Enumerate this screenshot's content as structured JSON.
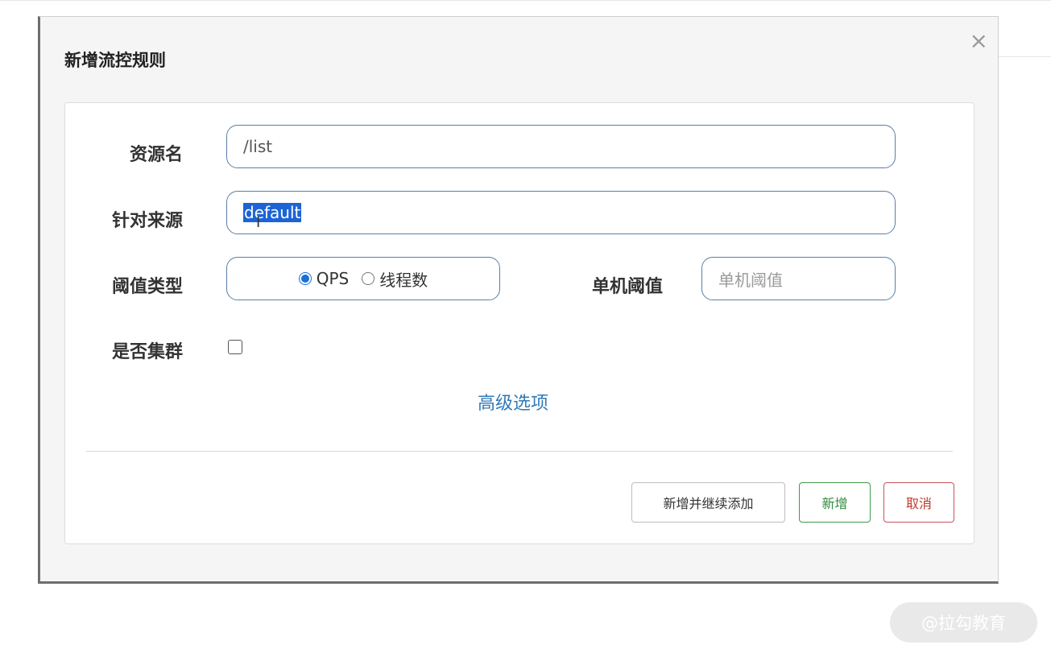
{
  "dialog": {
    "title": "新增流控规则",
    "close_glyph": "×"
  },
  "form": {
    "resource": {
      "label": "资源名",
      "value": "/list"
    },
    "origin": {
      "label": "针对来源",
      "value": "default"
    },
    "threshold_type": {
      "label": "阈值类型",
      "options": [
        {
          "label": "QPS",
          "checked": true
        },
        {
          "label": "线程数",
          "checked": false
        }
      ]
    },
    "single_threshold": {
      "label": "单机阈值",
      "placeholder": "单机阈值"
    },
    "cluster": {
      "label": "是否集群",
      "checked": false
    },
    "advanced_link": "高级选项"
  },
  "footer": {
    "add_continue_label": "新增并继续添加",
    "add_label": "新增",
    "cancel_label": "取消"
  },
  "colors": {
    "primary": "#1a6fd9",
    "success": "#2e8b3c",
    "danger": "#c0392b",
    "link": "#337ab7"
  },
  "watermark": "@拉勾教育"
}
